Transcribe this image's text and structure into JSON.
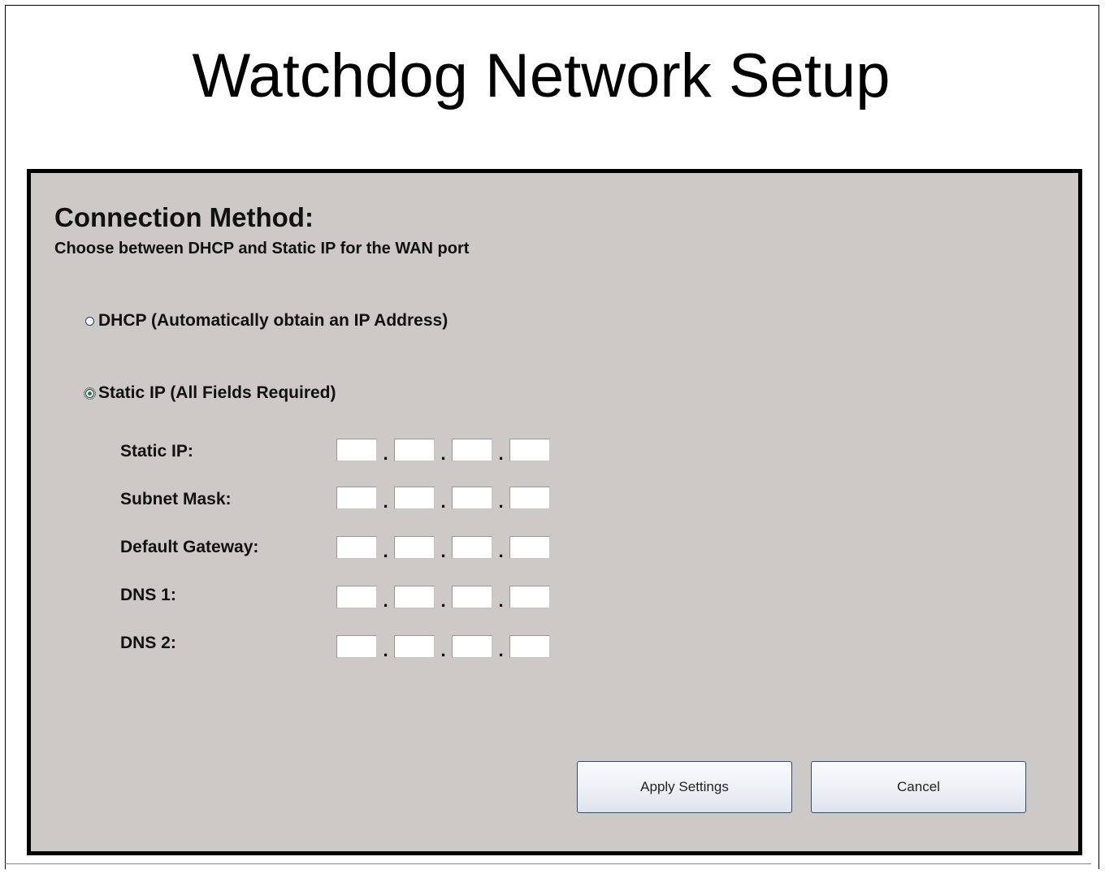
{
  "page": {
    "title": "Watchdog Network Setup"
  },
  "section": {
    "title": "Connection Method:",
    "subtitle": "Choose between DHCP and Static IP for the WAN port"
  },
  "options": {
    "dhcp": {
      "label": "DHCP (Automatically obtain an IP Address)",
      "selected": false
    },
    "static": {
      "label": "Static IP (All Fields Required)",
      "selected": true
    }
  },
  "fields": [
    {
      "label": "Static IP:",
      "octets": [
        "",
        "",
        "",
        ""
      ]
    },
    {
      "label": "Subnet Mask:",
      "octets": [
        "",
        "",
        "",
        ""
      ]
    },
    {
      "label": "Default Gateway:",
      "octets": [
        "",
        "",
        "",
        ""
      ]
    },
    {
      "label": "DNS 1:",
      "octets": [
        "",
        "",
        "",
        ""
      ]
    },
    {
      "label": "DNS 2:",
      "octets": [
        "",
        "",
        "",
        ""
      ]
    }
  ],
  "ip_separator": ".",
  "buttons": {
    "apply": "Apply Settings",
    "cancel": "Cancel"
  },
  "colors": {
    "panel_bg": "#ccc9c6",
    "panel_border": "#000000",
    "button_border": "#2b4f7f"
  }
}
